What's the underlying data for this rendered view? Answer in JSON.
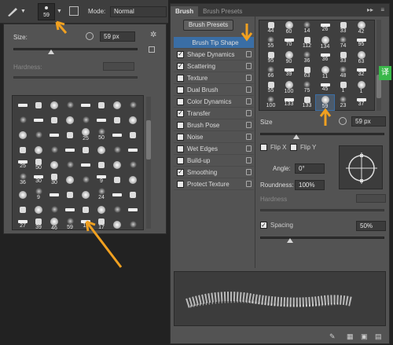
{
  "toolbar": {
    "brush_size_value": "59",
    "mode_label": "Mode:",
    "mode_value": "Normal"
  },
  "left_picker": {
    "size_label": "Size:",
    "size_value": "59 px",
    "hardness_label": "Hardness:",
    "grid": [
      [
        "",
        "",
        "",
        "",
        "",
        "",
        "",
        ""
      ],
      [
        "",
        "",
        "",
        "",
        "",
        "",
        "",
        ""
      ],
      [
        "",
        "",
        "",
        "",
        "25",
        "50",
        "",
        ""
      ],
      [
        "",
        "",
        "",
        "",
        "",
        "",
        "",
        ""
      ],
      [
        "25",
        "50",
        "",
        "",
        "",
        "",
        "",
        ""
      ],
      [
        "36",
        "30",
        "30",
        "",
        "",
        "9",
        "",
        ""
      ],
      [
        "",
        "9",
        "",
        "",
        "",
        "24",
        "",
        ""
      ],
      [
        "",
        "",
        "",
        "",
        "",
        "",
        "",
        ""
      ],
      [
        "27",
        "39",
        "46",
        "59",
        "11",
        "17",
        "",
        ""
      ]
    ]
  },
  "brush_panel": {
    "tab_brush": "Brush",
    "tab_presets": "Brush Presets",
    "presets_button": "Brush Presets",
    "options": [
      {
        "label": "Brush Tip Shape",
        "checked": false,
        "selected": true
      },
      {
        "label": "Shape Dynamics",
        "checked": true
      },
      {
        "label": "Scattering",
        "checked": true
      },
      {
        "label": "Texture",
        "checked": false
      },
      {
        "label": "Dual Brush",
        "checked": false
      },
      {
        "label": "Color Dynamics",
        "checked": false
      },
      {
        "label": "Transfer",
        "checked": true
      },
      {
        "label": "Brush Pose",
        "checked": false
      },
      {
        "label": "Noise",
        "checked": false
      },
      {
        "label": "Wet Edges",
        "checked": false
      },
      {
        "label": "Build-up",
        "checked": false
      },
      {
        "label": "Smoothing",
        "checked": true
      },
      {
        "label": "Protect Texture",
        "checked": false
      }
    ],
    "tip_grid": [
      [
        "44",
        "60",
        "14",
        "26",
        "33",
        "42"
      ],
      [
        "55",
        "70",
        "112",
        "134",
        "74",
        "95"
      ],
      [
        "95",
        "90",
        "36",
        "36",
        "33",
        "63"
      ],
      [
        "66",
        "39",
        "63",
        "11",
        "48",
        "32"
      ],
      [
        "55",
        "100",
        "75",
        "45",
        "1",
        "1"
      ],
      [
        "100",
        "133",
        "133",
        "59",
        "23",
        "37"
      ]
    ],
    "size_label": "Size",
    "size_value": "59 px",
    "flip_x": "Flip X",
    "flip_y": "Flip Y",
    "angle_label": "Angle:",
    "angle_value": "0°",
    "roundness_label": "Roundness:",
    "roundness_value": "100%",
    "hardness_label": "Hardness",
    "spacing_label": "Spacing",
    "spacing_value": "50%"
  },
  "side_badge": "译",
  "colors": {
    "arrow": "#f0a020",
    "selected": "#3a6ea5"
  }
}
